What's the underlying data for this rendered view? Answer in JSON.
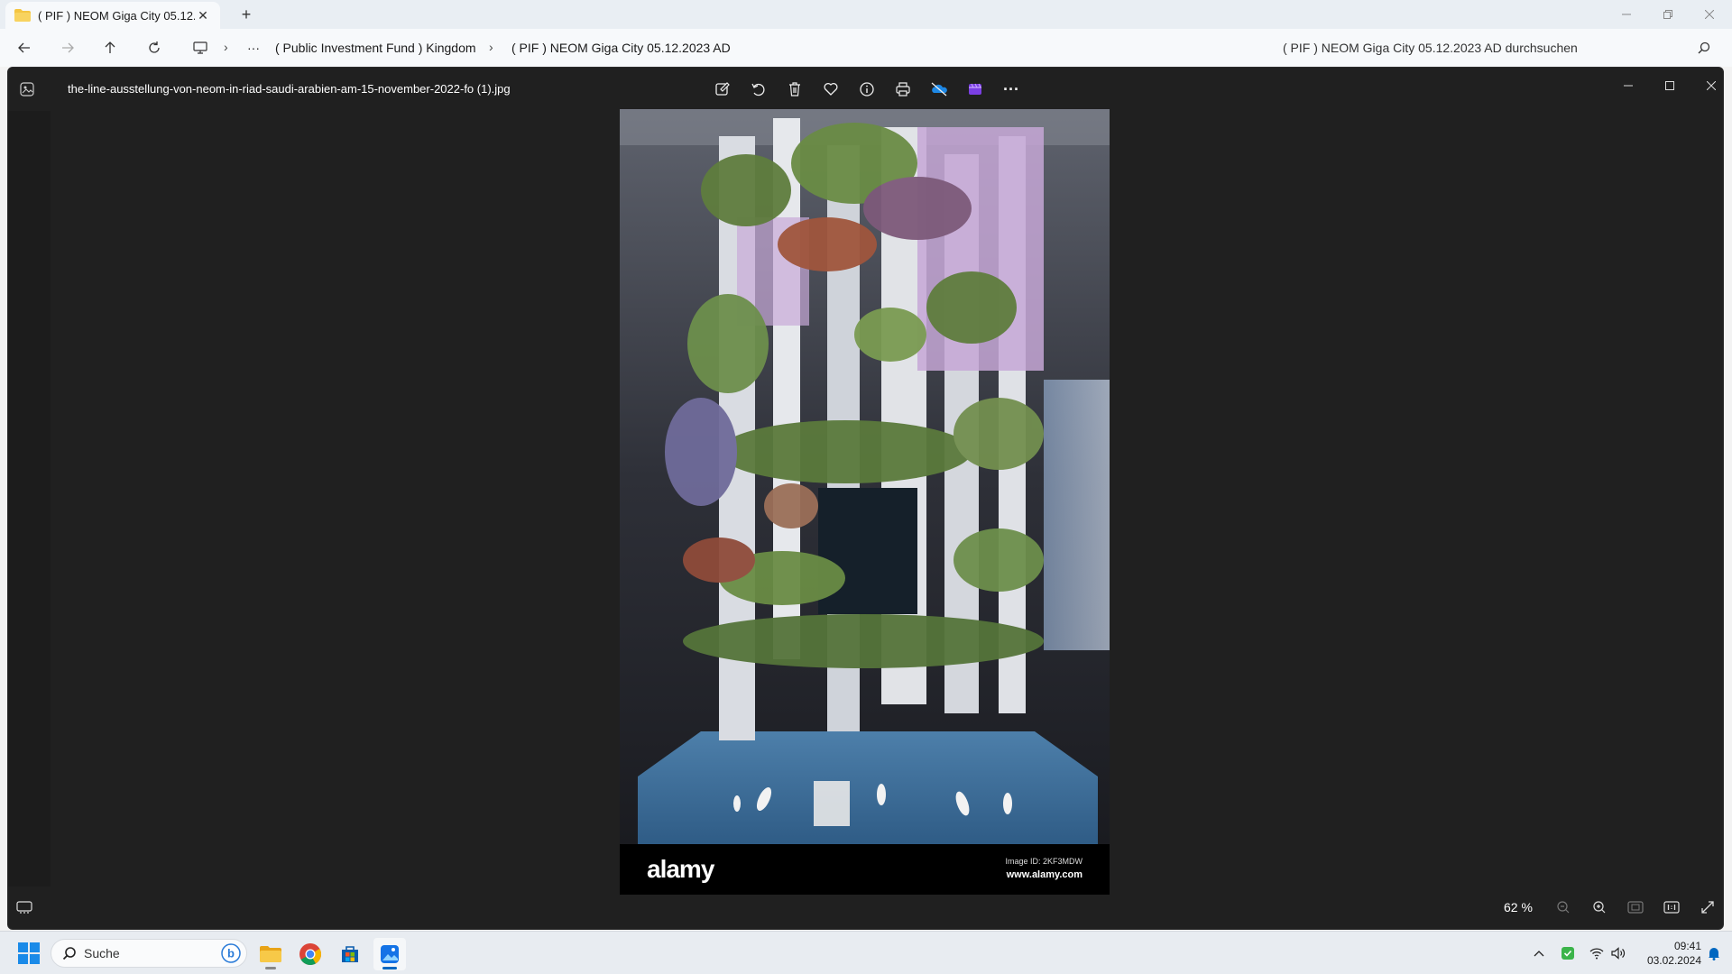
{
  "explorer": {
    "tab_title": "( PIF ) NEOM Giga City 05.12.2",
    "new_tab": "+",
    "breadcrumb_more": "···",
    "breadcrumb": [
      "( Public Investment Fund ) Kingdom",
      "( PIF ) NEOM Giga City 05.12.2023 AD"
    ],
    "search_placeholder": "( PIF ) NEOM Giga City 05.12.2023 AD durchsuchen"
  },
  "viewer": {
    "file_name": "the-line-ausstellung-von-neom-in-riad-saudi-arabien-am-15-november-2022-fo (1).jpg",
    "toolbar": [
      "edit-icon",
      "rotate-icon",
      "delete-icon",
      "favorite-icon",
      "info-icon",
      "print-icon",
      "onedrive-icon",
      "clipchamp-icon",
      "more-icon"
    ],
    "more_label": "···",
    "zoom_level": "62 %",
    "image": {
      "footer_logo": "alamy",
      "image_id": "Image ID: 2KF3MDW",
      "url": "www.alamy.com"
    }
  },
  "taskbar": {
    "search_label": "Suche",
    "time": "09:41",
    "date": "03.02.2024"
  },
  "colors": {
    "accent": "#0067c0",
    "viewer_bg": "#202020",
    "folder": "#f4c542"
  }
}
